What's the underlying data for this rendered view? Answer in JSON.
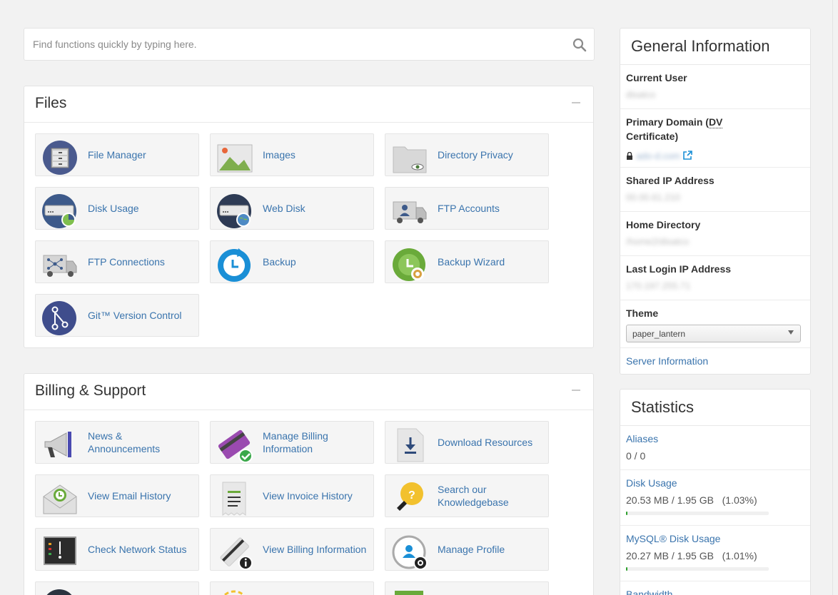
{
  "search": {
    "placeholder": "Find functions quickly by typing here."
  },
  "files": {
    "title": "Files",
    "items": [
      {
        "label": "File Manager",
        "icon": "file-manager-icon"
      },
      {
        "label": "Images",
        "icon": "images-icon"
      },
      {
        "label": "Directory Privacy",
        "icon": "directory-privacy-icon"
      },
      {
        "label": "Disk Usage",
        "icon": "disk-usage-icon"
      },
      {
        "label": "Web Disk",
        "icon": "web-disk-icon"
      },
      {
        "label": "FTP Accounts",
        "icon": "ftp-accounts-icon"
      },
      {
        "label": "FTP Connections",
        "icon": "ftp-connections-icon"
      },
      {
        "label": "Backup",
        "icon": "backup-icon"
      },
      {
        "label": "Backup Wizard",
        "icon": "backup-wizard-icon"
      },
      {
        "label": "Git™ Version Control",
        "icon": "git-icon"
      }
    ]
  },
  "billing": {
    "title": "Billing & Support",
    "items": [
      {
        "label": "News & Announcements",
        "icon": "megaphone-icon"
      },
      {
        "label": "Manage Billing Information",
        "icon": "credit-card-icon"
      },
      {
        "label": "Download Resources",
        "icon": "download-icon"
      },
      {
        "label": "View Email History",
        "icon": "email-history-icon"
      },
      {
        "label": "View Invoice History",
        "icon": "invoice-icon"
      },
      {
        "label": "Search our Knowledgebase",
        "icon": "lightbulb-icon"
      },
      {
        "label": "Check Network Status",
        "icon": "network-status-icon"
      },
      {
        "label": "View Billing Information",
        "icon": "billing-info-icon"
      },
      {
        "label": "Manage Profile",
        "icon": "profile-icon"
      }
    ]
  },
  "general": {
    "title": "General Information",
    "current_user_label": "Current User",
    "current_user_value": "disatco",
    "primary_domain_label_a": "Primary Domain (",
    "primary_domain_dv": "DV",
    "primary_domain_label_b": "Certificate)",
    "primary_domain_value": "ado-d.com",
    "shared_ip_label": "Shared IP Address",
    "shared_ip_value": "00.00.61.210",
    "home_dir_label": "Home Directory",
    "home_dir_value": "/home2/disatco",
    "last_login_label": "Last Login IP Address",
    "last_login_value": "170.197.255.71",
    "theme_label": "Theme",
    "theme_value": "paper_lantern",
    "server_info_link": "Server Information"
  },
  "statistics": {
    "title": "Statistics",
    "rows": [
      {
        "label": "Aliases",
        "value": "0 / 0"
      },
      {
        "label": "Disk Usage",
        "value": "20.53 MB / 1.95 GB   (1.03%)",
        "percent": 1.03
      },
      {
        "label": "MySQL® Disk Usage",
        "value": "20.27 MB / 1.95 GB   (1.01%)",
        "percent": 1.01
      },
      {
        "label": "Bandwidth"
      }
    ]
  },
  "colors": {
    "link": "#3a74ad",
    "progress": "#2ca02c"
  }
}
